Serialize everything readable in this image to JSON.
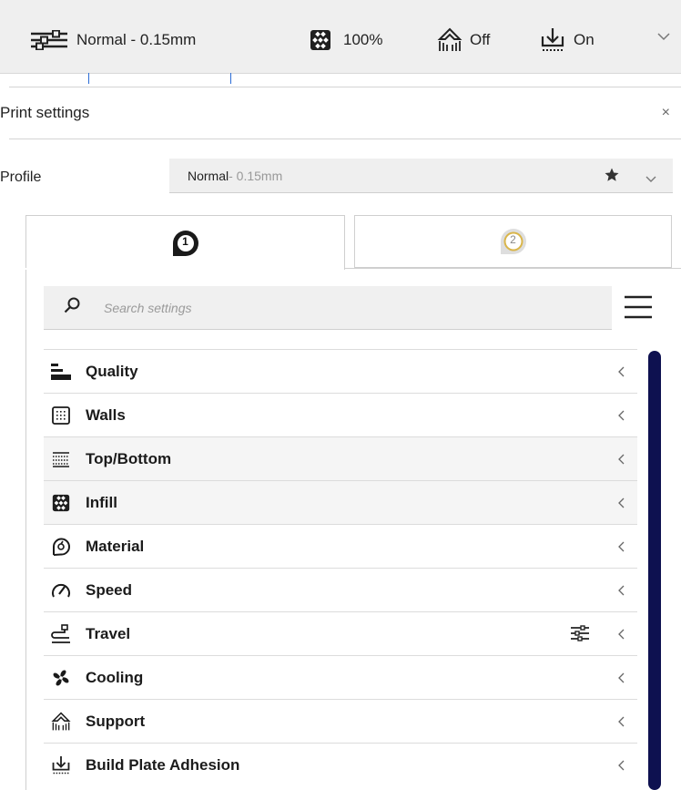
{
  "topbar": {
    "profile_label": "Normal - 0.15mm",
    "infill_label": "100%",
    "support_label": "Off",
    "adhesion_label": "On",
    "icons": [
      "settings-sliders-icon",
      "infill-icon",
      "support-icon",
      "adhesion-icon",
      "chevron-down-icon"
    ]
  },
  "print_settings": {
    "title": "Print settings",
    "close_label": "×"
  },
  "profile": {
    "label": "Profile",
    "name": "Normal",
    "detail": " - 0.15mm"
  },
  "extruders": [
    {
      "number": "1",
      "state": "active"
    },
    {
      "number": "2",
      "state": "inactive"
    }
  ],
  "search": {
    "placeholder": "Search settings"
  },
  "categories": [
    {
      "label": "Quality",
      "icon": "quality-icon"
    },
    {
      "label": "Walls",
      "icon": "walls-icon"
    },
    {
      "label": "Top/Bottom",
      "icon": "top-bottom-icon"
    },
    {
      "label": "Infill",
      "icon": "infill-icon"
    },
    {
      "label": "Material",
      "icon": "material-icon"
    },
    {
      "label": "Speed",
      "icon": "speed-icon"
    },
    {
      "label": "Travel",
      "icon": "travel-icon"
    },
    {
      "label": "Cooling",
      "icon": "cooling-icon"
    },
    {
      "label": "Support",
      "icon": "support-icon"
    },
    {
      "label": "Build Plate Adhesion",
      "icon": "build-plate-adhesion-icon"
    }
  ],
  "colors": {
    "scrollbar": "#0e1150",
    "extruder_2_ring": "#d9b54a",
    "tab_accent": "#2b6cd6"
  }
}
